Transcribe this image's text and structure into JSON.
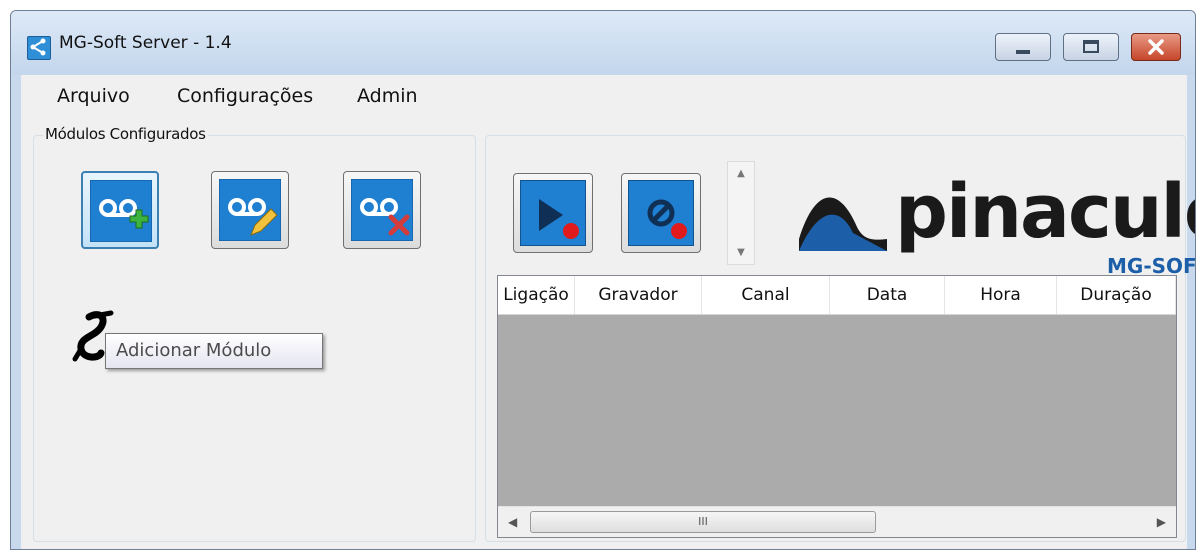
{
  "window": {
    "title": "MG-Soft Server - 1.4"
  },
  "menu": [
    "Arquivo",
    "Configurações",
    "Admin"
  ],
  "modules_group": {
    "label": "Módulos Configurados"
  },
  "module_buttons": [
    {
      "name": "add-module",
      "icon": "voicemail-add-icon"
    },
    {
      "name": "edit-module",
      "icon": "voicemail-edit-icon"
    },
    {
      "name": "delete-module",
      "icon": "voicemail-delete-icon"
    }
  ],
  "tooltip": "Adicionar Módulo",
  "toolbar": [
    {
      "name": "start-recording",
      "icon": "play-record-icon"
    },
    {
      "name": "stop-recording",
      "icon": "stop-record-icon"
    }
  ],
  "logo": {
    "brand": "pinaculo",
    "sub": "MG-SOFT"
  },
  "table": {
    "columns": [
      "Ligação",
      "Gravador",
      "Canal",
      "Data",
      "Hora",
      "Duração"
    ],
    "rows": []
  },
  "scrollbar": {
    "thumb_glyph": "III"
  },
  "colors": {
    "accent": "#1f7fd1",
    "logo_dark": "#1a1a1a",
    "logo_blue": "#1c5fa8"
  }
}
